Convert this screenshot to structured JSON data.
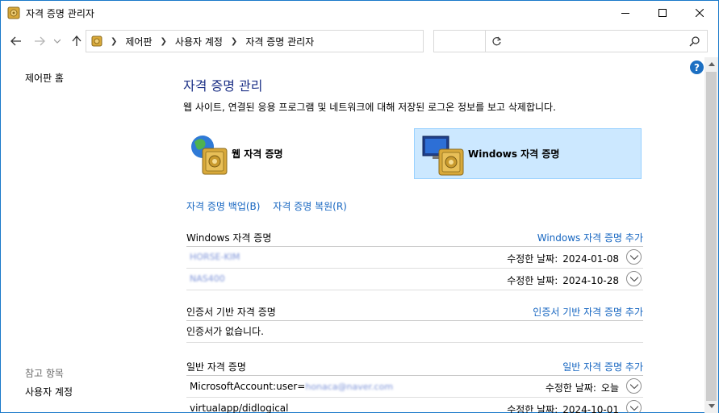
{
  "window": {
    "title": "자격 증명 관리자"
  },
  "address": {
    "crumbs": [
      "제어판",
      "사용자 계정",
      "자격 증명 관리자"
    ],
    "search_placeholder": ""
  },
  "left": {
    "home": "제어판 홈",
    "see_also": "참고 항목",
    "user_accounts": "사용자 계정"
  },
  "main": {
    "title": "자격 증명 관리",
    "description": "웹 사이트, 연결된 응용 프로그램 및 네트워크에 대해 저장된 로그온 정보를 보고 삭제합니다.",
    "tile_web": "웹 자격 증명",
    "tile_windows": "Windows 자격 증명",
    "backup_link": "자격 증명 백업(B)",
    "restore_link": "자격 증명 복원(R)"
  },
  "windows_section": {
    "title": "Windows 자격 증명",
    "add": "Windows 자격 증명 추가",
    "rows": [
      {
        "name": "HORSE-KIM",
        "date_label": "수정한 날짜:",
        "date": "2024-01-08"
      },
      {
        "name": "NAS400",
        "date_label": "수정한 날짜:",
        "date": "2024-10-28"
      }
    ]
  },
  "cert_section": {
    "title": "인증서 기반 자격 증명",
    "add": "인증서 기반 자격 증명 추가",
    "empty": "인증서가 없습니다."
  },
  "generic_section": {
    "title": "일반 자격 증명",
    "add": "일반 자격 증명 추가",
    "rows": [
      {
        "name_prefix": "MicrosoftAccount:user=",
        "name_blur": "honaca@naver.com",
        "date_label": "수정한 날짜:",
        "date": "오늘"
      },
      {
        "name_prefix": "virtualapp/didlogical",
        "name_blur": "",
        "date_label": "수정한 날짜:",
        "date": "2024-10-01"
      }
    ]
  },
  "colors": {
    "link": "#1565c0",
    "title": "#1e3287",
    "selected_tile": "#cce8ff",
    "help_badge": "#1c6fc2"
  },
  "icons": {
    "app": "vault-icon",
    "web_tile": "globe-vault-icon",
    "windows_tile": "monitor-vault-icon",
    "help": "help-icon"
  },
  "help_glyph": "?"
}
